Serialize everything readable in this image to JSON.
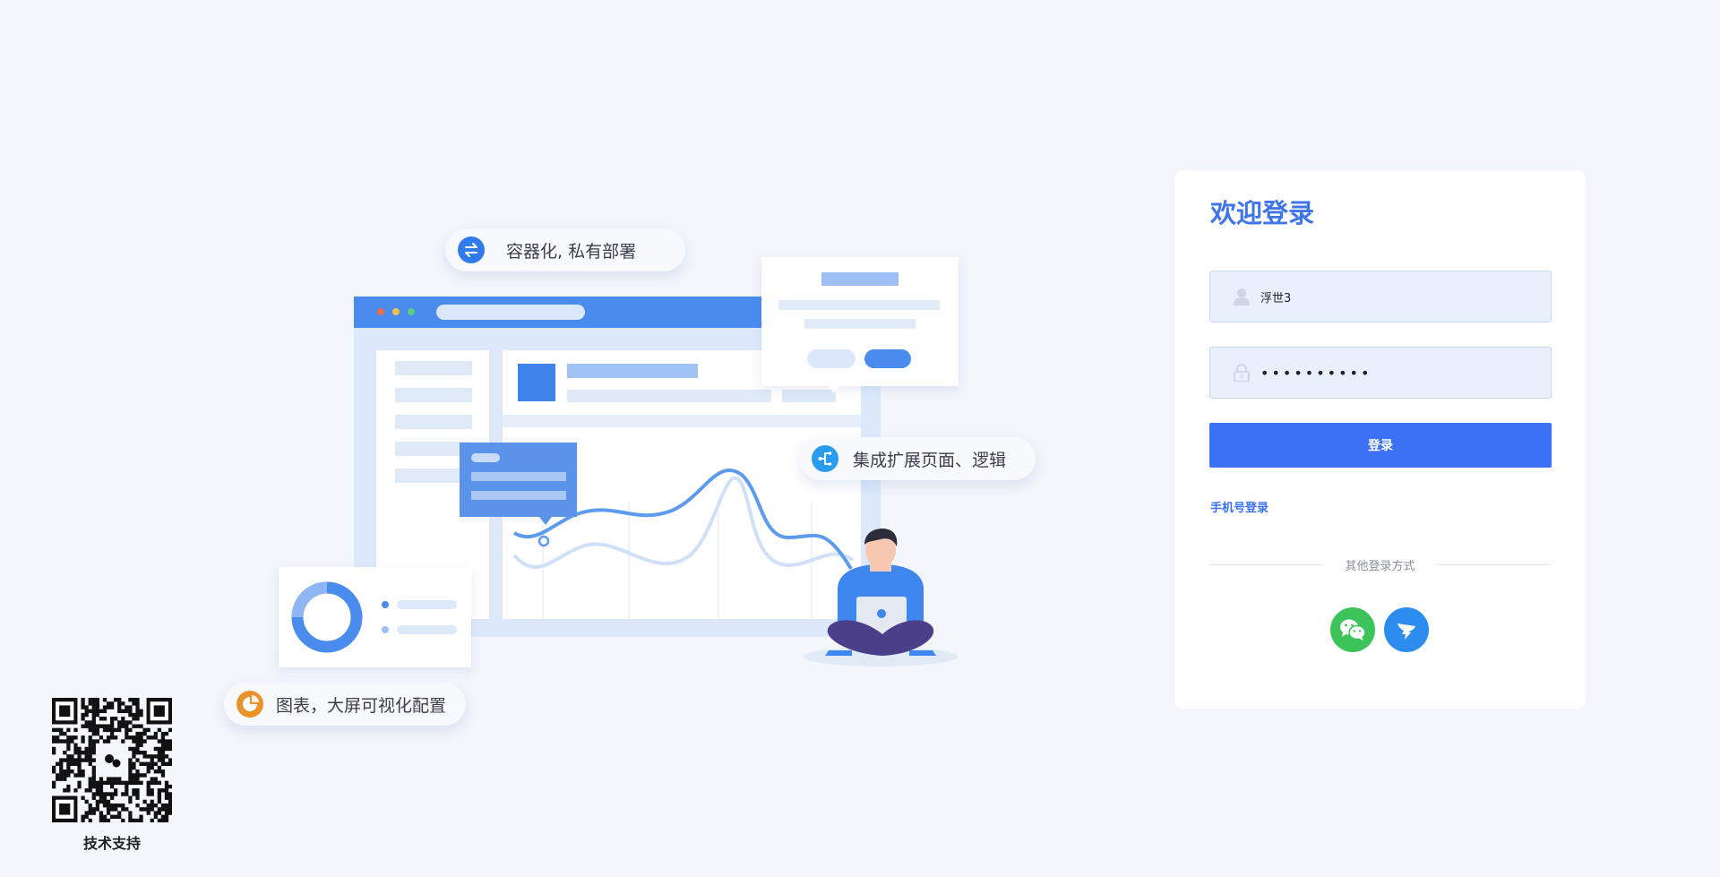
{
  "features": {
    "deploy": "容器化, 私有部署",
    "extend": "集成扩展页面、逻辑",
    "charts": "图表，大屏可视化配置"
  },
  "login": {
    "title": "欢迎登录",
    "username_value": "浮世3",
    "password_value": "••••••••••",
    "submit_label": "登录",
    "phone_login_label": "手机号登录",
    "other_methods_label": "其他登录方式"
  },
  "social": {
    "wechat_icon": "wechat-icon",
    "dingtalk_icon": "dingtalk-icon"
  },
  "support": {
    "caption": "技术支持"
  },
  "colors": {
    "primary": "#3b71f5",
    "title": "#3f74ea",
    "wechat": "#3cc45b",
    "dingtalk": "#2d8cf0",
    "chart_orange": "#e8932a"
  }
}
